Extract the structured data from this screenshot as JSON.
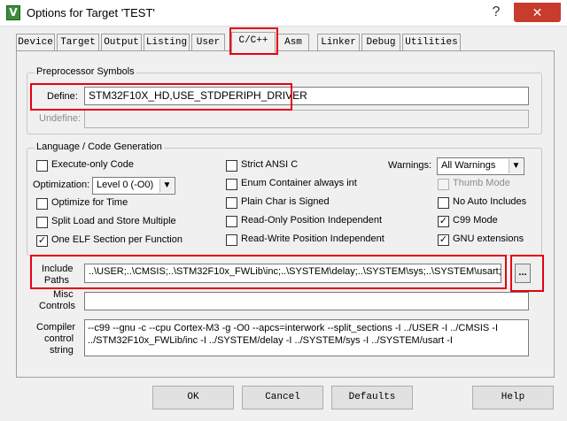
{
  "window": {
    "title": "Options for Target 'TEST'",
    "app_icon": "V",
    "help_symbol": "?",
    "close_symbol": "✕"
  },
  "tabs": [
    "Device",
    "Target",
    "Output",
    "Listing",
    "User",
    "C/C++",
    "Asm",
    "Linker",
    "Debug",
    "Utilities"
  ],
  "active_tab": "C/C++",
  "preprocessor": {
    "group_label": "Preprocessor Symbols",
    "define_label": "Define:",
    "define_value": "STM32F10X_HD,USE_STDPERIPH_DRIVER",
    "undefine_label": "Undefine:",
    "undefine_value": ""
  },
  "language": {
    "group_label": "Language / Code Generation",
    "execute_only": {
      "label": "Execute-only Code",
      "checked": false
    },
    "optimization_label": "Optimization:",
    "optimization_value": "Level 0 (-O0)",
    "optimize_time": {
      "label": "Optimize for Time",
      "checked": false
    },
    "split_load": {
      "label": "Split Load and Store Multiple",
      "checked": false
    },
    "one_elf": {
      "label": "One ELF Section per Function",
      "checked": true
    },
    "strict_ansi": {
      "label": "Strict ANSI C",
      "checked": false
    },
    "enum_container": {
      "label": "Enum Container always int",
      "checked": false
    },
    "plain_char": {
      "label": "Plain Char is Signed",
      "checked": false
    },
    "ropi": {
      "label": "Read-Only Position Independent",
      "checked": false
    },
    "rwpi": {
      "label": "Read-Write Position Independent",
      "checked": false
    },
    "warnings_label": "Warnings:",
    "warnings_value": "All Warnings",
    "thumb_mode": {
      "label": "Thumb Mode",
      "checked": false
    },
    "no_auto_includes": {
      "label": "No Auto Includes",
      "checked": false
    },
    "c99_mode": {
      "label": "C99 Mode",
      "checked": true
    },
    "gnu_extensions": {
      "label": "GNU extensions",
      "checked": true
    }
  },
  "include": {
    "label_line1": "Include",
    "label_line2": "Paths",
    "value": "..\\USER;..\\CMSIS;..\\STM32F10x_FWLib\\inc;..\\SYSTEM\\delay;..\\SYSTEM\\sys;..\\SYSTEM\\usart;..\\HARDWARE",
    "browse_label": "..."
  },
  "misc": {
    "label_line1": "Misc",
    "label_line2": "Controls",
    "value": ""
  },
  "compiler": {
    "label_line1": "Compiler",
    "label_line2": "control",
    "label_line3": "string",
    "line1": "--c99 --gnu -c --cpu Cortex-M3 -g -O0 --apcs=interwork --split_sections -I ../USER -I ../CMSIS -I",
    "line2": "../STM32F10x_FWLib/inc -I ../SYSTEM/delay -I ../SYSTEM/sys -I ../SYSTEM/usart -I"
  },
  "buttons": {
    "ok": "OK",
    "cancel": "Cancel",
    "defaults": "Defaults",
    "help": "Help"
  },
  "colors": {
    "highlight": "#e60012",
    "close_button": "#c83c2d"
  }
}
